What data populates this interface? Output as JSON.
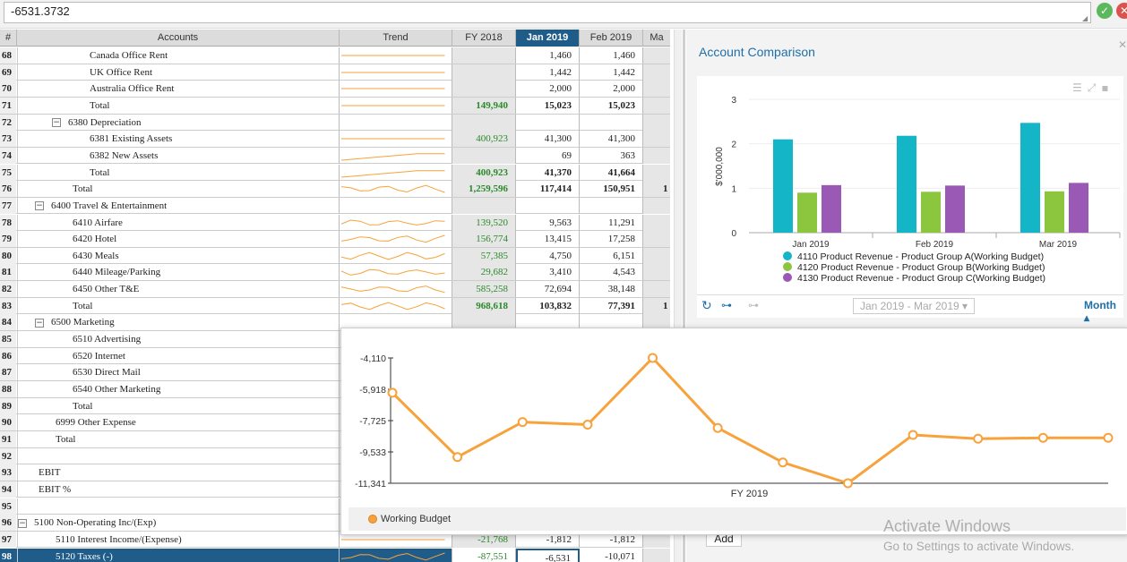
{
  "formula_bar": {
    "value": "-6531.3732"
  },
  "grid": {
    "headers": {
      "num": "#",
      "accounts": "Accounts",
      "trend": "Trend",
      "fy2018": "FY 2018",
      "jan2019": "Jan 2019",
      "feb2019": "Feb 2019",
      "mar": "Ma"
    },
    "rows": [
      {
        "num": "68",
        "label": "Canada Office Rent",
        "fy": "",
        "jan": "1,460",
        "feb": "1,460",
        "mar": "",
        "bold": false
      },
      {
        "num": "69",
        "label": "UK Office Rent",
        "fy": "",
        "jan": "1,442",
        "feb": "1,442",
        "mar": "",
        "bold": false
      },
      {
        "num": "70",
        "label": "Australia Office Rent",
        "fy": "",
        "jan": "2,000",
        "feb": "2,000",
        "mar": "",
        "bold": false
      },
      {
        "num": "71",
        "label": "Total",
        "fy": "149,940",
        "jan": "15,023",
        "feb": "15,023",
        "mar": "",
        "bold": true
      },
      {
        "num": "72",
        "label": "6380 Depreciation",
        "fy": "",
        "jan": "",
        "feb": "",
        "mar": "",
        "bold": false,
        "expander": "−"
      },
      {
        "num": "73",
        "label": "6381 Existing Assets",
        "fy": "400,923",
        "jan": "41,300",
        "feb": "41,300",
        "mar": "",
        "bold": false
      },
      {
        "num": "74",
        "label": "6382 New Assets",
        "fy": "",
        "jan": "69",
        "feb": "363",
        "mar": "",
        "bold": false
      },
      {
        "num": "75",
        "label": "Total",
        "fy": "400,923",
        "jan": "41,370",
        "feb": "41,664",
        "mar": "",
        "bold": true
      },
      {
        "num": "76",
        "label": "Total",
        "fy": "1,259,596",
        "jan": "117,414",
        "feb": "150,951",
        "mar": "1",
        "bold": true
      },
      {
        "num": "77",
        "label": "6400 Travel & Entertainment",
        "fy": "",
        "jan": "",
        "feb": "",
        "mar": "",
        "bold": false,
        "expander": "−"
      },
      {
        "num": "78",
        "label": "6410 Airfare",
        "fy": "139,520",
        "jan": "9,563",
        "feb": "11,291",
        "mar": "",
        "bold": false
      },
      {
        "num": "79",
        "label": "6420 Hotel",
        "fy": "156,774",
        "jan": "13,415",
        "feb": "17,258",
        "mar": "",
        "bold": false
      },
      {
        "num": "80",
        "label": "6430 Meals",
        "fy": "57,385",
        "jan": "4,750",
        "feb": "6,151",
        "mar": "",
        "bold": false
      },
      {
        "num": "81",
        "label": "6440 Mileage/Parking",
        "fy": "29,682",
        "jan": "3,410",
        "feb": "4,543",
        "mar": "",
        "bold": false
      },
      {
        "num": "82",
        "label": "6450 Other T&E",
        "fy": "585,258",
        "jan": "72,694",
        "feb": "38,148",
        "mar": "",
        "bold": false
      },
      {
        "num": "83",
        "label": "Total",
        "fy": "968,618",
        "jan": "103,832",
        "feb": "77,391",
        "mar": "1",
        "bold": true
      },
      {
        "num": "84",
        "label": "6500 Marketing",
        "fy": "",
        "jan": "",
        "feb": "",
        "mar": "",
        "bold": false,
        "expander": "−"
      },
      {
        "num": "85",
        "label": "6510 Advertising",
        "fy": "",
        "jan": "",
        "feb": "",
        "mar": "",
        "bold": false
      },
      {
        "num": "86",
        "label": "6520 Internet",
        "fy": "",
        "jan": "",
        "feb": "",
        "mar": "",
        "bold": false
      },
      {
        "num": "87",
        "label": "6530 Direct Mail",
        "fy": "",
        "jan": "",
        "feb": "",
        "mar": "",
        "bold": false
      },
      {
        "num": "88",
        "label": "6540 Other Marketing",
        "fy": "",
        "jan": "",
        "feb": "",
        "mar": "",
        "bold": false
      },
      {
        "num": "89",
        "label": "Total",
        "fy": "",
        "jan": "",
        "feb": "",
        "mar": "",
        "bold": false
      },
      {
        "num": "90",
        "label": "6999 Other Expense",
        "fy": "",
        "jan": "",
        "feb": "",
        "mar": "",
        "bold": false
      },
      {
        "num": "91",
        "label": "Total",
        "fy": "",
        "jan": "",
        "feb": "",
        "mar": "",
        "bold": false
      },
      {
        "num": "92",
        "label": "",
        "fy": "",
        "jan": "",
        "feb": "",
        "mar": "",
        "bold": false
      },
      {
        "num": "93",
        "label": "EBIT",
        "fy": "",
        "jan": "",
        "feb": "",
        "mar": "",
        "bold": false
      },
      {
        "num": "94",
        "label": "EBIT %",
        "fy": "",
        "jan": "",
        "feb": "",
        "mar": "",
        "bold": false
      },
      {
        "num": "95",
        "label": "",
        "fy": "",
        "jan": "",
        "feb": "",
        "mar": "",
        "bold": false
      },
      {
        "num": "96",
        "label": "5100 Non-Operating Inc/(Exp)",
        "fy": "",
        "jan": "",
        "feb": "",
        "mar": "",
        "bold": false,
        "expander": "−"
      },
      {
        "num": "97",
        "label": "5110 Interest Income/(Expense)",
        "fy": "-21,768",
        "jan": "-1,812",
        "feb": "-1,812",
        "mar": "",
        "bold": false
      },
      {
        "num": "98",
        "label": "5120 Taxes (-)",
        "fy": "-87,551",
        "jan": "-6,531",
        "feb": "-10,071",
        "mar": "",
        "bold": false,
        "selected": true
      }
    ]
  },
  "comparison_panel": {
    "title": "Account Comparison",
    "date_range": "Jan 2019 - Mar 2019",
    "period": "Month",
    "add_label": "Add"
  },
  "chart_data": [
    {
      "type": "bar",
      "title": "",
      "ylabel": "$'000,000",
      "ylim": [
        0,
        3
      ],
      "yticks": [
        "0",
        "1",
        "2",
        "3"
      ],
      "categories": [
        "Jan 2019",
        "Feb 2019",
        "Mar 2019"
      ],
      "series": [
        {
          "name": "4110 Product Revenue - Product Group A(Working Budget)",
          "values": [
            2.1,
            2.18,
            2.47
          ],
          "color": "#13b5c7"
        },
        {
          "name": "4120 Product Revenue - Product Group B(Working Budget)",
          "values": [
            0.9,
            0.92,
            0.93
          ],
          "color": "#8cc63f"
        },
        {
          "name": "4130 Product Revenue - Product Group C(Working Budget)",
          "values": [
            1.07,
            1.06,
            1.12
          ],
          "color": "#9b59b6"
        }
      ],
      "legend": "bottom"
    },
    {
      "type": "line",
      "xlabel": "FY 2019",
      "ylim": [
        -11341,
        -4110
      ],
      "yticks": [
        "-4,110",
        "-5,918",
        "-7,725",
        "-9,533",
        "-11,341"
      ],
      "series": [
        {
          "name": "Working Budget",
          "color": "#f7a23b",
          "values": [
            -6120,
            -9830,
            -7810,
            -7960,
            -4110,
            -8150,
            -10140,
            -11340,
            -8550,
            -8770,
            -8720,
            -8720
          ]
        }
      ],
      "legend": "bottom-left"
    }
  ],
  "watermark": {
    "line1": "Activate Windows",
    "line2": "Go to Settings to activate Windows."
  }
}
